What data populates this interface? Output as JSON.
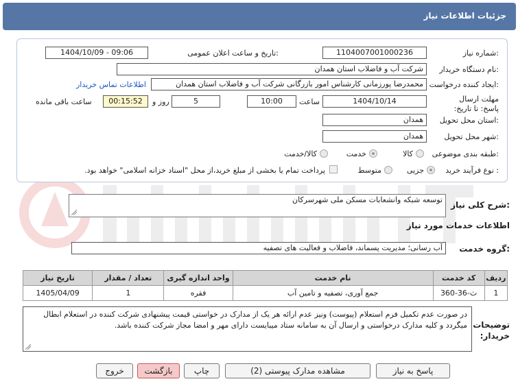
{
  "header": {
    "title": "جزئیات اطلاعات نیاز"
  },
  "fields": {
    "need_number_label": "شماره نیاز:",
    "need_number": "1104007001000236",
    "announce_label": "تاریخ و ساعت اعلان عمومی:",
    "announce_value": "1404/10/09 - 09:06",
    "buyer_label": "نام دستگاه خریدار:",
    "buyer_value": "شرکت آب و فاضلاب استان همدان",
    "creator_label": "ایجاد کننده درخواست:",
    "creator_value": "محمدرضا پورزمانی کارشناس امور بازرگانی شرکت آب و فاضلاب استان همدان",
    "contact_link": "اطلاعات تماس خریدار",
    "deadline_label": "مهلت ارسال پاسخ: تا تاریخ:",
    "deadline_date": "1404/10/14",
    "time_label": "ساعت",
    "deadline_time": "10:00",
    "days_value": "5",
    "days_label": "روز و",
    "remaining_time": "00:15:52",
    "remaining_label": "ساعت باقی مانده",
    "province_label": "استان محل تحویل:",
    "province_value": "همدان",
    "city_label": "شهر محل تحویل:",
    "city_value": "همدان",
    "category_label": "طبقه بندی موضوعی:",
    "category_options": [
      "کالا",
      "خدمت",
      "کالا/خدمت"
    ],
    "process_label": "نوع فرآیند خرید :",
    "process_options": [
      "جزیی",
      "متوسط"
    ],
    "payment_note": "پرداخت تمام یا بخشی از مبلغ خرید،از محل \"اسناد خزانه اسلامی\" خواهد بود."
  },
  "summary": {
    "label": "شرح کلی نیاز:",
    "value": "توسعه شبکه وانشعابات مسکن ملی شهرسرکان"
  },
  "services": {
    "section_title": "اطلاعات خدمات مورد نیاز",
    "group_label": "گروه خدمت:",
    "group_value": "آب رسانی؛ مدیریت پسماند، فاضلاب و فعالیت های تصفیه",
    "table": {
      "headers": [
        "ردیف",
        "کد خدمت",
        "نام خدمت",
        "واحد اندازه گیری",
        "تعداد / مقدار",
        "تاریخ نیاز"
      ],
      "rows": [
        [
          "1",
          "ث-36-360",
          "جمع آوری، تصفیه و تامین آب",
          "فقره",
          "1",
          "1405/04/09"
        ]
      ]
    }
  },
  "buyer_notes": {
    "label": "توضیحات خریدار:",
    "text": "در صورت عدم تکمیل فرم استعلام (پیوست) ونیز عدم ارائه هر یک از مدارک در خواستی قیمت پیشنهادی شرکت کننده در استعلام ابطال میگردد و کلیه مدارک درخواستی و ارسال آن به سامانه ستاد میبایست دارای مهر و امضا مجاز شرکت کننده باشد."
  },
  "buttons": {
    "reply": "پاسخ به نیاز",
    "attachments": "مشاهده مدارک پیوستی (2)",
    "print": "چاپ",
    "back": "بازگشت",
    "exit": "خروج"
  },
  "colors": {
    "header_bg": "#5677a6",
    "link": "#1a56c2",
    "timer_bg": "#fff8cc",
    "table_header": "#d6d6d6",
    "back_button": "#f5c9c9"
  }
}
